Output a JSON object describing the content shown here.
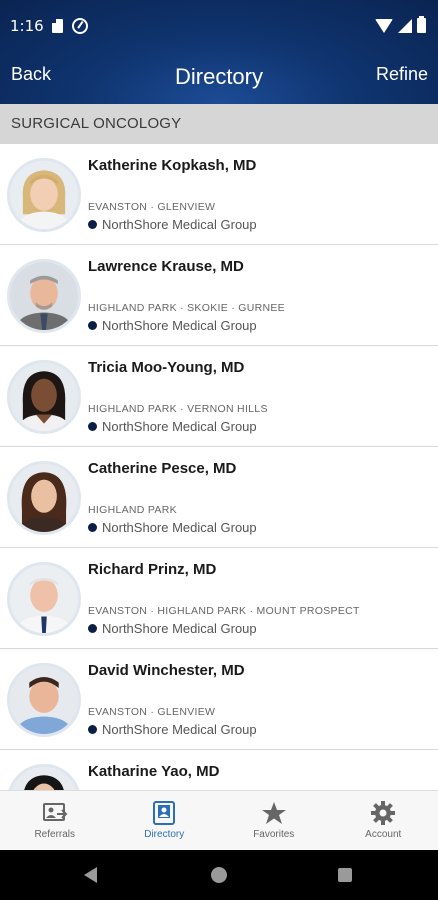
{
  "status_bar": {
    "time": "1:16"
  },
  "header": {
    "back_label": "Back",
    "title": "Directory",
    "refine_label": "Refine"
  },
  "section": {
    "title": "SURGICAL ONCOLOGY"
  },
  "doctors": [
    {
      "name": "Katherine Kopkash, MD",
      "locations": "EVANSTON · GLENVIEW",
      "group": "NorthShore Medical Group"
    },
    {
      "name": "Lawrence Krause, MD",
      "locations": "HIGHLAND PARK · SKOKIE · GURNEE",
      "group": "NorthShore Medical Group"
    },
    {
      "name": "Tricia Moo-Young, MD",
      "locations": "HIGHLAND PARK · VERNON HILLS",
      "group": "NorthShore Medical Group"
    },
    {
      "name": "Catherine Pesce, MD",
      "locations": "HIGHLAND PARK",
      "group": "NorthShore Medical Group"
    },
    {
      "name": "Richard Prinz, MD",
      "locations": "EVANSTON · HIGHLAND PARK · MOUNT PROSPECT",
      "group": "NorthShore Medical Group"
    },
    {
      "name": "David Winchester, MD",
      "locations": "EVANSTON · GLENVIEW",
      "group": "NorthShore Medical Group"
    },
    {
      "name": "Katharine Yao, MD",
      "locations": "",
      "group": ""
    }
  ],
  "tabs": [
    {
      "label": "Referrals",
      "icon": "referrals-icon"
    },
    {
      "label": "Directory",
      "icon": "directory-icon"
    },
    {
      "label": "Favorites",
      "icon": "star-icon"
    },
    {
      "label": "Account",
      "icon": "gear-icon"
    }
  ],
  "colors": {
    "header": "#0f346f",
    "active_tab": "#2c6fb6",
    "group_dot": "#0b1f46"
  }
}
